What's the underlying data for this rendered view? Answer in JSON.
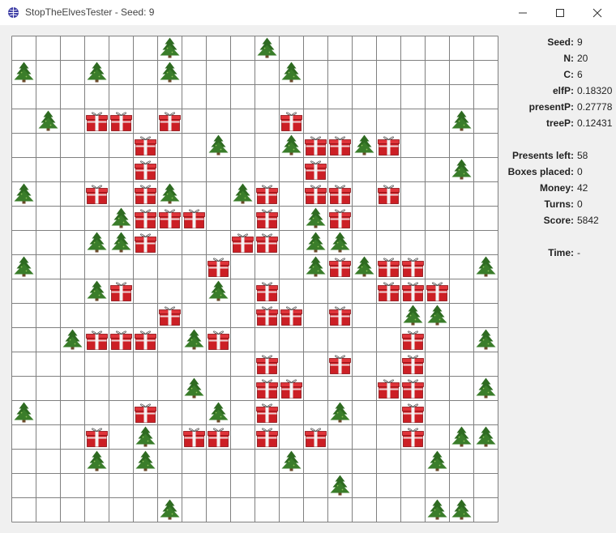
{
  "window": {
    "title": "StopTheElvesTester - Seed: 9",
    "icon": "globe-icon",
    "controls": [
      "minimize-icon",
      "maximize-icon",
      "close-icon"
    ]
  },
  "board": {
    "size": 20,
    "legend": {
      "T": "tree-icon",
      "P": "present-icon",
      ".": "empty"
    },
    "rows": [
      "......T...T.........",
      "T..T..T....T........",
      "....................",
      ".T.PP.P....P......T.",
      ".....P..T..TPPTP....",
      ".....P......P.....T.",
      "T..P.PT..TP.PP.P....",
      "....TPPP..P.TP......",
      "...TTP...PP.TT......",
      "T.......P...TPTPP..T",
      "...TP...T.P....PPP..",
      "......P...PP.P..TT..",
      "..TPPP.TP.......P..T",
      "..........P..P..P...",
      ".......T..PP...PP..T",
      "T....P..T.P..T..P...",
      "...P.T.PP.P.P...P.TT",
      "...T.T.....T.....T..",
      ".............T......",
      "......T..........TT."
    ]
  },
  "stats": [
    {
      "label": "Seed:",
      "value": "9"
    },
    {
      "label": "N:",
      "value": "20"
    },
    {
      "label": "C:",
      "value": "6"
    },
    {
      "label": "elfP:",
      "value": "0.18320"
    },
    {
      "label": "presentP:",
      "value": "0.27778"
    },
    {
      "label": "treeP:",
      "value": "0.12431"
    },
    {
      "label": "Presents left:",
      "value": "58"
    },
    {
      "label": "Boxes placed:",
      "value": "0"
    },
    {
      "label": "Money:",
      "value": "42"
    },
    {
      "label": "Turns:",
      "value": "0"
    },
    {
      "label": "Score:",
      "value": "5842"
    },
    {
      "label": "Time:",
      "value": "-"
    }
  ],
  "colors": {
    "present": "#cc1f25",
    "tree": "#2e6b21",
    "grid": "#808080"
  }
}
